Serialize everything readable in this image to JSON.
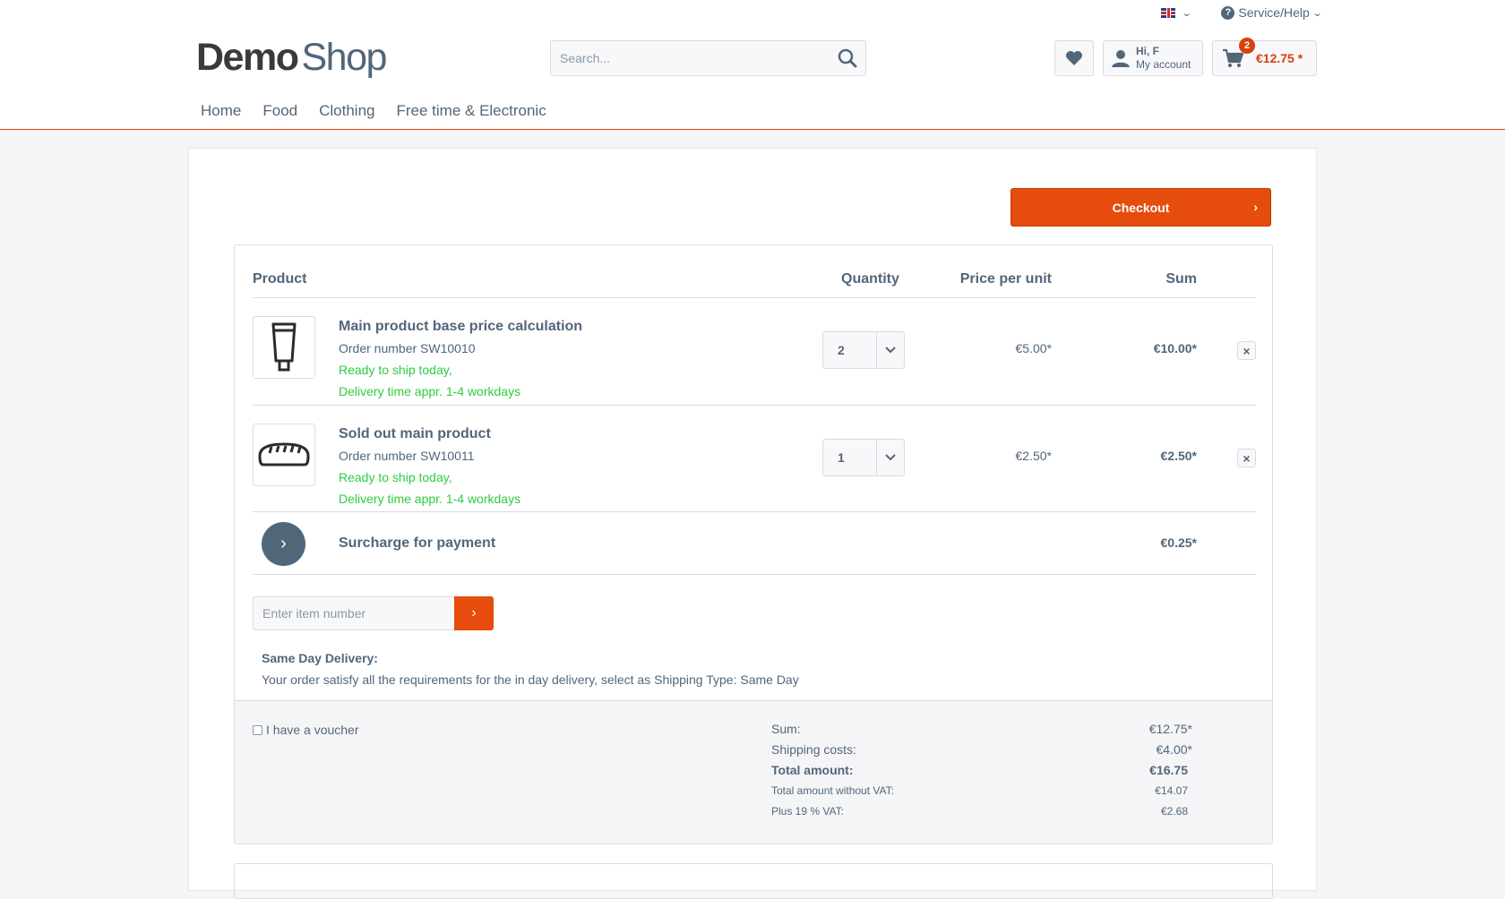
{
  "header": {
    "language": "English",
    "service_help": "Service/Help",
    "logo": {
      "bold": "Demo",
      "light": "Shop"
    },
    "search_placeholder": "Search...",
    "account": {
      "greeting": "Hi, F",
      "label": "My account"
    },
    "cart": {
      "count": "2",
      "total": "€12.75 *"
    }
  },
  "nav": [
    "Home",
    "Food",
    "Clothing",
    "Free time & Electronic"
  ],
  "checkout_label": "Checkout",
  "table": {
    "headers": {
      "product": "Product",
      "quantity": "Quantity",
      "price": "Price per unit",
      "sum": "Sum"
    },
    "items": [
      {
        "name": "Main product base price calculation",
        "order_number": "Order number SW10010",
        "availability": "Ready to ship today,",
        "delivery": "Delivery time appr. 1-4 workdays",
        "quantity": "2",
        "unit_price": "€5.00*",
        "sum": "€10.00*",
        "icon": "tube-icon"
      },
      {
        "name": "Sold out main product",
        "order_number": "Order number SW10011",
        "availability": "Ready to ship today,",
        "delivery": "Delivery time appr. 1-4 workdays",
        "quantity": "1",
        "unit_price": "€2.50*",
        "sum": "€2.50*",
        "icon": "bread-icon"
      }
    ],
    "surcharge": {
      "label": "Surcharge for payment",
      "sum": "€0.25*"
    }
  },
  "add_item_placeholder": "Enter item number",
  "same_day": {
    "title": "Same Day Delivery:",
    "text": "Your order satisfy all the requirements for the in day delivery, select as Shipping Type: Same Day"
  },
  "voucher_label": "I have a voucher",
  "totals": {
    "sum_label": "Sum:",
    "sum_value": "€12.75*",
    "shipping_label": "Shipping costs:",
    "shipping_value": "€4.00*",
    "total_label": "Total amount:",
    "total_value": "€16.75",
    "net_label": "Total amount without VAT:",
    "net_value": "€14.07",
    "vat_label": "Plus 19 % VAT:",
    "vat_value": "€2.68"
  },
  "colors": {
    "accent": "#e54c0e",
    "text": "#52667a",
    "green": "#2ecc40"
  }
}
